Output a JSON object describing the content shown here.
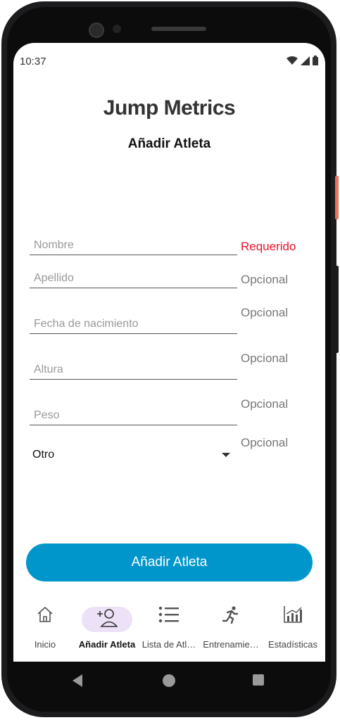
{
  "status_bar": {
    "time": "10:37"
  },
  "app": {
    "title": "Jump Metrics",
    "subtitle": "Añadir Atleta"
  },
  "form": {
    "fields": [
      {
        "placeholder": "Nombre",
        "value": "",
        "hint": "Requerido"
      },
      {
        "placeholder": "Apellido",
        "value": "",
        "hint": "Opcional"
      },
      {
        "placeholder": "Fecha de nacimiento",
        "value": "",
        "hint": "Opcional"
      },
      {
        "placeholder": "Altura",
        "value": "",
        "hint": "Opcional"
      },
      {
        "placeholder": "Peso",
        "value": "",
        "hint": "Opcional"
      }
    ],
    "select": {
      "value": "Otro",
      "hint": "Opcional"
    },
    "submit_label": "Añadir Atleta"
  },
  "nav": {
    "items": [
      {
        "label": "Inicio",
        "icon": "home-icon"
      },
      {
        "label": "Añadir Atleta",
        "icon": "add-person-icon",
        "active": true
      },
      {
        "label": "Lista de Atletas",
        "icon": "list-icon"
      },
      {
        "label": "Entrenamientos",
        "icon": "running-icon"
      },
      {
        "label": "Estadísticas",
        "icon": "bar-chart-icon"
      }
    ]
  },
  "colors": {
    "accent": "#0096cc",
    "required": "#e8132a",
    "active_pill": "#ece1f6"
  }
}
